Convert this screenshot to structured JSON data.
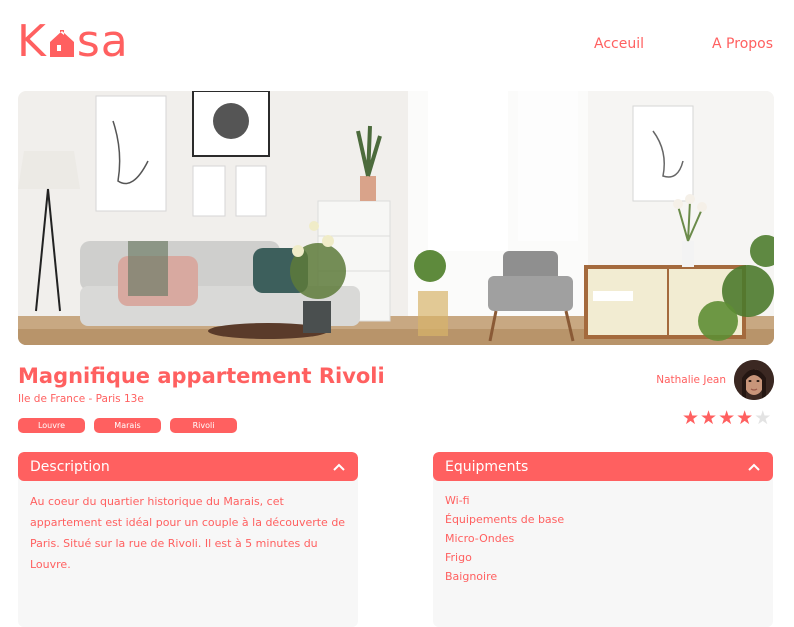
{
  "brand": {
    "logo_left": "K",
    "logo_right": "sa",
    "logo_icon": "house-icon",
    "color": "#FF6060"
  },
  "nav": {
    "home": "Acceuil",
    "about": "A Propos"
  },
  "banner": {
    "image_alt_icon": "apartment-photo"
  },
  "listing": {
    "title": "Magnifique appartement Rivoli",
    "location": "Ile de France - Paris 13e",
    "tags": [
      "Louvre",
      "Marais",
      "Rivoli"
    ]
  },
  "host": {
    "name": "Nathalie Jean",
    "rating": 4,
    "rating_max": 5
  },
  "description": {
    "label": "Description",
    "text": "Au coeur du quartier historique du Marais, cet appartement est idéal pour un couple à la découverte de Paris. Situé sur la rue de Rivoli. Il est à 5 minutes du Louvre."
  },
  "equipments": {
    "label": "Equipments",
    "items": [
      "Wi-fi",
      "Équipements de base",
      "Micro-Ondes",
      "Frigo",
      "Baignoire"
    ]
  }
}
